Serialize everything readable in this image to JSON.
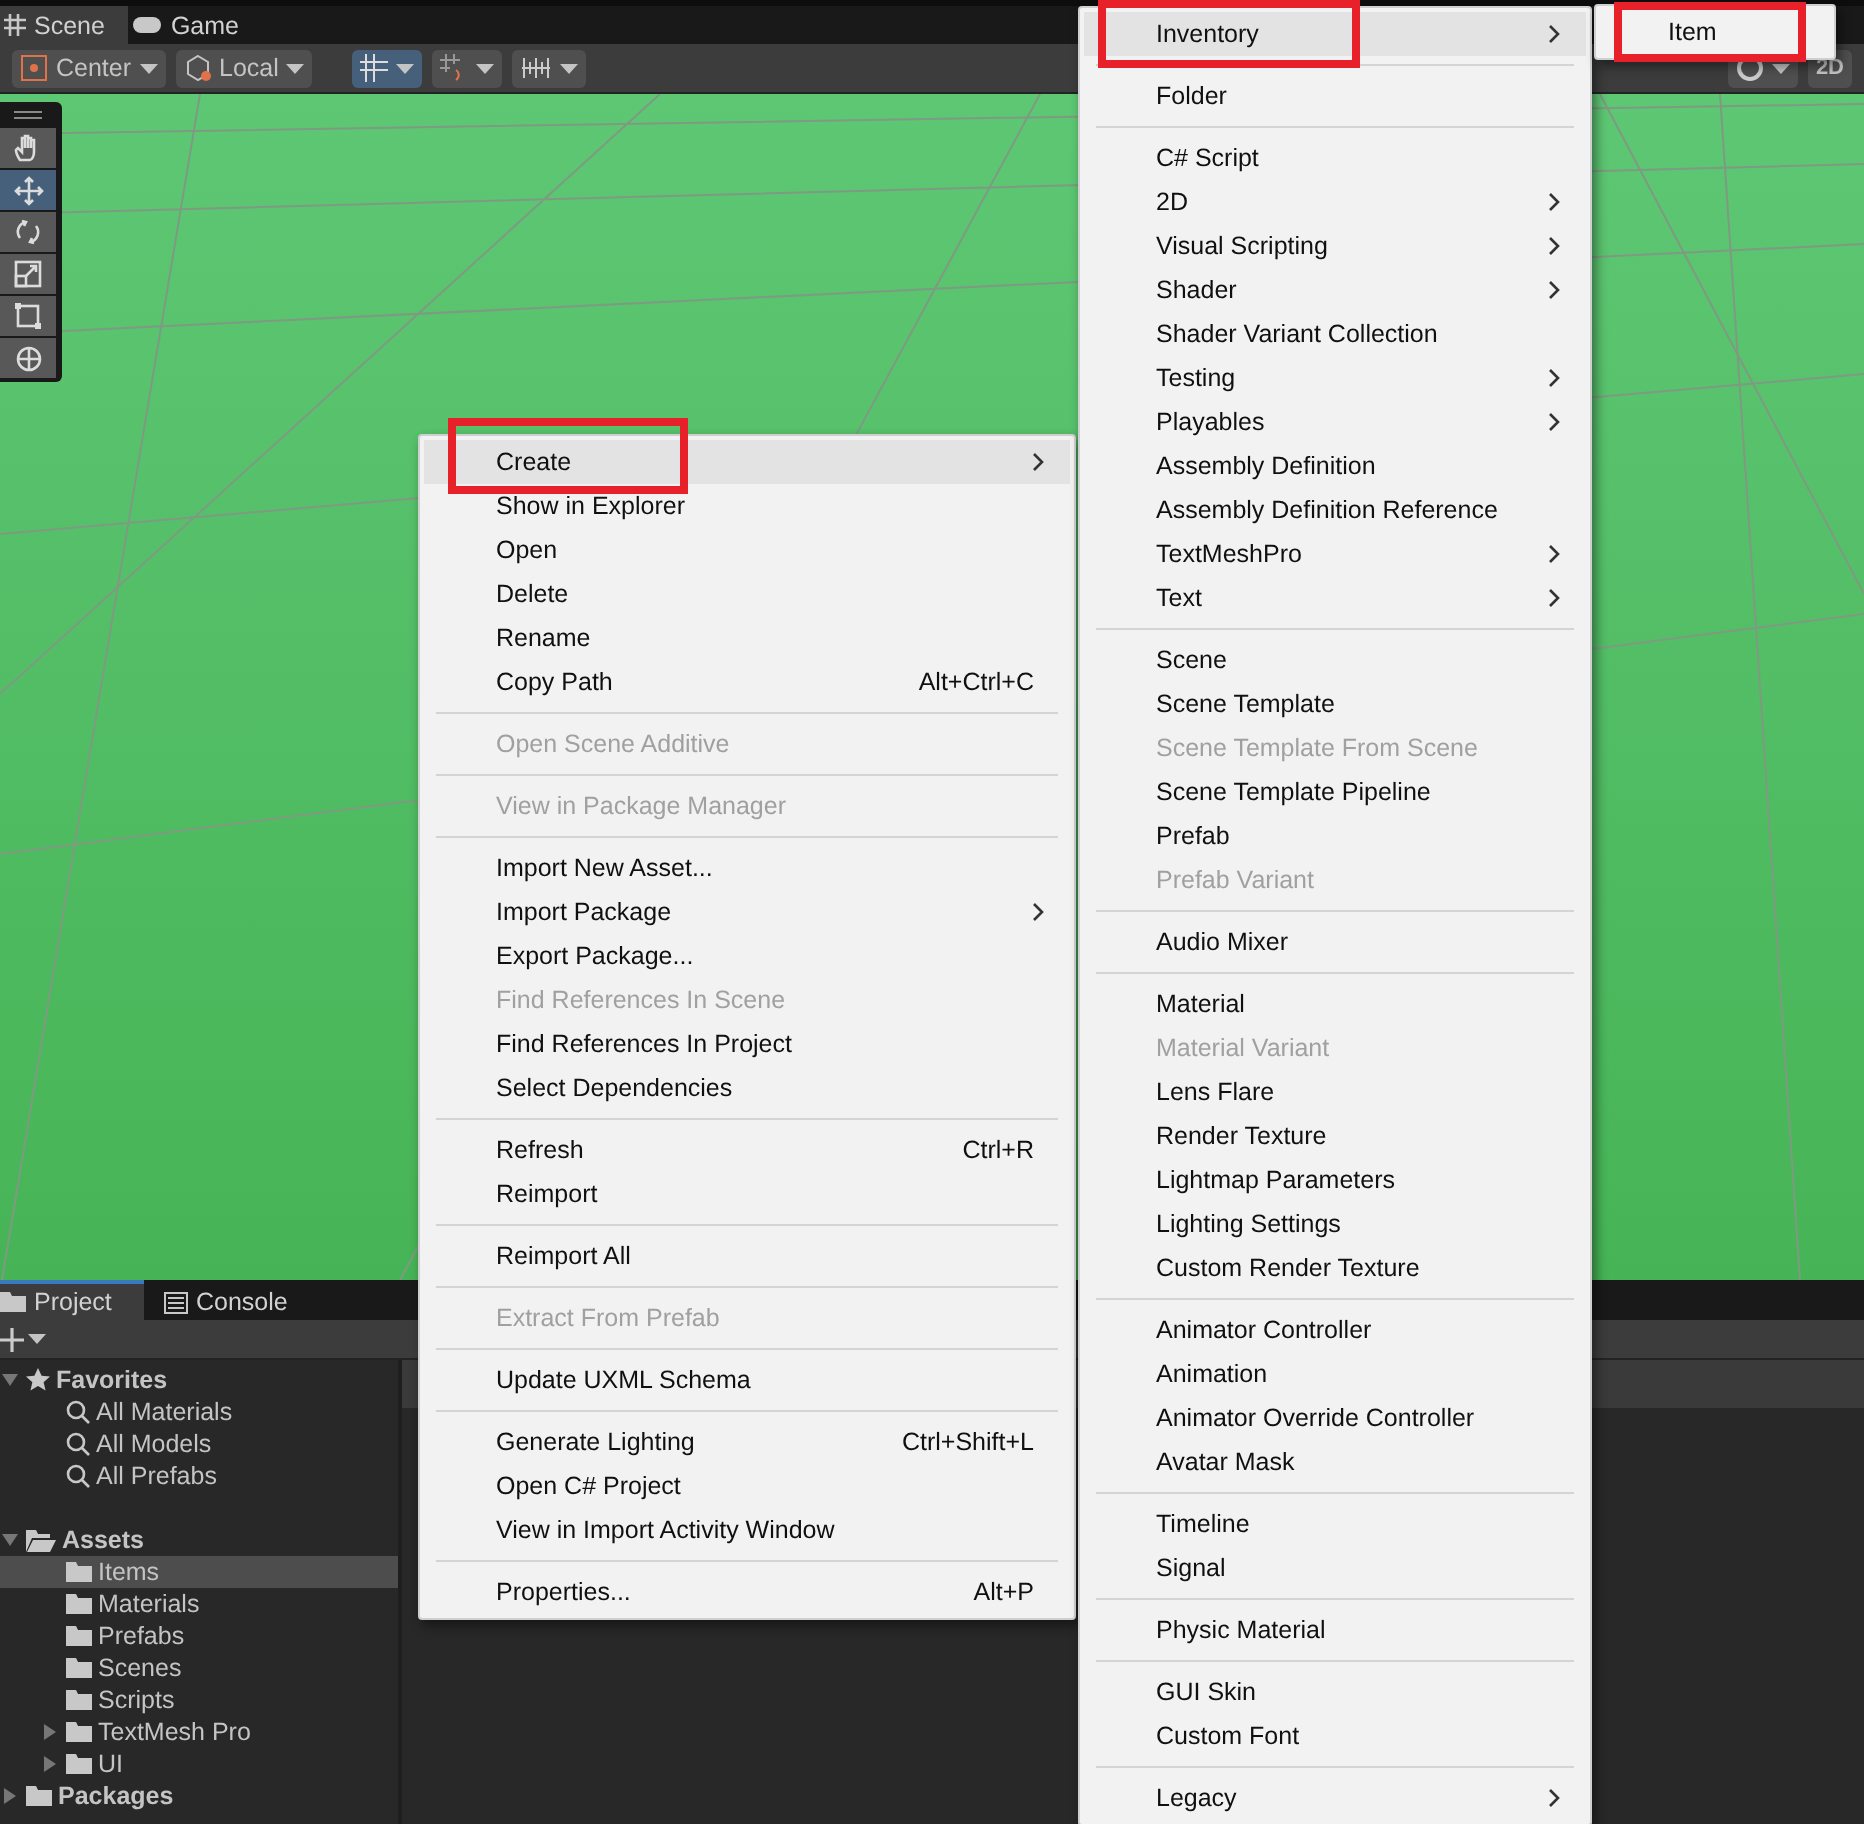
{
  "scene_tabs": [
    {
      "label": "Scene",
      "kind": "grid",
      "selected": true
    },
    {
      "label": "Game",
      "kind": "gamepad",
      "selected": false
    }
  ],
  "scene_toolbar": {
    "pivot": "Center",
    "space": "Local",
    "grid_snap_on": true,
    "view_mode": "2D"
  },
  "tools": [
    {
      "kind": "hand",
      "selected": false
    },
    {
      "kind": "move",
      "selected": true
    },
    {
      "kind": "rotate",
      "selected": false
    },
    {
      "kind": "scale",
      "selected": false
    },
    {
      "kind": "rect",
      "selected": false
    },
    {
      "kind": "transform",
      "selected": false
    }
  ],
  "bottom_tabs": [
    {
      "label": "Project",
      "kind": "folder",
      "selected": true
    },
    {
      "label": "Console",
      "kind": "console",
      "selected": false
    }
  ],
  "project_tree": [
    {
      "label": "Favorites",
      "kind": "star",
      "expanded": true,
      "selected": false,
      "children": [
        {
          "label": "All Materials",
          "kind": "search",
          "selected": false
        },
        {
          "label": "All Models",
          "kind": "search",
          "selected": false
        },
        {
          "label": "All Prefabs",
          "kind": "search",
          "selected": false
        }
      ]
    },
    {
      "label": "Assets",
      "kind": "folder",
      "expanded": true,
      "selected": false,
      "children": [
        {
          "label": "Items",
          "kind": "folder",
          "selected": true
        },
        {
          "label": "Materials",
          "kind": "folder",
          "selected": false
        },
        {
          "label": "Prefabs",
          "kind": "folder",
          "selected": false
        },
        {
          "label": "Scenes",
          "kind": "folder",
          "selected": false
        },
        {
          "label": "Scripts",
          "kind": "folder",
          "selected": false
        },
        {
          "label": "TextMesh Pro",
          "kind": "folder",
          "expanded": false,
          "selected": false
        },
        {
          "label": "UI",
          "kind": "folder",
          "expanded": false,
          "selected": false
        }
      ]
    },
    {
      "label": "Packages",
      "kind": "folder",
      "expanded": false,
      "selected": false
    }
  ],
  "context_menu": {
    "items": [
      {
        "kind": "item",
        "label": "Create",
        "submenu": true,
        "hovered": true,
        "highlighted": true
      },
      {
        "kind": "item",
        "label": "Show in Explorer"
      },
      {
        "kind": "item",
        "label": "Open"
      },
      {
        "kind": "item",
        "label": "Delete"
      },
      {
        "kind": "item",
        "label": "Rename"
      },
      {
        "kind": "item",
        "label": "Copy Path",
        "shortcut": "Alt+Ctrl+C"
      },
      {
        "kind": "separator"
      },
      {
        "kind": "item",
        "label": "Open Scene Additive",
        "disabled": true
      },
      {
        "kind": "separator"
      },
      {
        "kind": "item",
        "label": "View in Package Manager",
        "disabled": true
      },
      {
        "kind": "separator"
      },
      {
        "kind": "item",
        "label": "Import New Asset..."
      },
      {
        "kind": "item",
        "label": "Import Package",
        "submenu": true
      },
      {
        "kind": "item",
        "label": "Export Package..."
      },
      {
        "kind": "item",
        "label": "Find References In Scene",
        "disabled": true
      },
      {
        "kind": "item",
        "label": "Find References In Project"
      },
      {
        "kind": "item",
        "label": "Select Dependencies"
      },
      {
        "kind": "separator"
      },
      {
        "kind": "item",
        "label": "Refresh",
        "shortcut": "Ctrl+R"
      },
      {
        "kind": "item",
        "label": "Reimport"
      },
      {
        "kind": "separator"
      },
      {
        "kind": "item",
        "label": "Reimport All"
      },
      {
        "kind": "separator"
      },
      {
        "kind": "item",
        "label": "Extract From Prefab",
        "disabled": true
      },
      {
        "kind": "separator"
      },
      {
        "kind": "item",
        "label": "Update UXML Schema"
      },
      {
        "kind": "separator"
      },
      {
        "kind": "item",
        "label": "Generate Lighting",
        "shortcut": "Ctrl+Shift+L"
      },
      {
        "kind": "item",
        "label": "Open C# Project"
      },
      {
        "kind": "item",
        "label": "View in Import Activity Window"
      },
      {
        "kind": "separator"
      },
      {
        "kind": "item",
        "label": "Properties...",
        "shortcut": "Alt+P"
      }
    ]
  },
  "create_menu": {
    "items": [
      {
        "kind": "item",
        "label": "Inventory",
        "submenu": true,
        "hovered": true,
        "highlighted": true
      },
      {
        "kind": "separator"
      },
      {
        "kind": "item",
        "label": "Folder"
      },
      {
        "kind": "separator"
      },
      {
        "kind": "item",
        "label": "C# Script"
      },
      {
        "kind": "item",
        "label": "2D",
        "submenu": true
      },
      {
        "kind": "item",
        "label": "Visual Scripting",
        "submenu": true
      },
      {
        "kind": "item",
        "label": "Shader",
        "submenu": true
      },
      {
        "kind": "item",
        "label": "Shader Variant Collection"
      },
      {
        "kind": "item",
        "label": "Testing",
        "submenu": true
      },
      {
        "kind": "item",
        "label": "Playables",
        "submenu": true
      },
      {
        "kind": "item",
        "label": "Assembly Definition"
      },
      {
        "kind": "item",
        "label": "Assembly Definition Reference"
      },
      {
        "kind": "item",
        "label": "TextMeshPro",
        "submenu": true
      },
      {
        "kind": "item",
        "label": "Text",
        "submenu": true
      },
      {
        "kind": "separator"
      },
      {
        "kind": "item",
        "label": "Scene"
      },
      {
        "kind": "item",
        "label": "Scene Template"
      },
      {
        "kind": "item",
        "label": "Scene Template From Scene",
        "disabled": true
      },
      {
        "kind": "item",
        "label": "Scene Template Pipeline"
      },
      {
        "kind": "item",
        "label": "Prefab"
      },
      {
        "kind": "item",
        "label": "Prefab Variant",
        "disabled": true
      },
      {
        "kind": "separator"
      },
      {
        "kind": "item",
        "label": "Audio Mixer"
      },
      {
        "kind": "separator"
      },
      {
        "kind": "item",
        "label": "Material"
      },
      {
        "kind": "item",
        "label": "Material Variant",
        "disabled": true
      },
      {
        "kind": "item",
        "label": "Lens Flare"
      },
      {
        "kind": "item",
        "label": "Render Texture"
      },
      {
        "kind": "item",
        "label": "Lightmap Parameters"
      },
      {
        "kind": "item",
        "label": "Lighting Settings"
      },
      {
        "kind": "item",
        "label": "Custom Render Texture"
      },
      {
        "kind": "separator"
      },
      {
        "kind": "item",
        "label": "Animator Controller"
      },
      {
        "kind": "item",
        "label": "Animation"
      },
      {
        "kind": "item",
        "label": "Animator Override Controller"
      },
      {
        "kind": "item",
        "label": "Avatar Mask"
      },
      {
        "kind": "separator"
      },
      {
        "kind": "item",
        "label": "Timeline"
      },
      {
        "kind": "item",
        "label": "Signal"
      },
      {
        "kind": "separator"
      },
      {
        "kind": "item",
        "label": "Physic Material"
      },
      {
        "kind": "separator"
      },
      {
        "kind": "item",
        "label": "GUI Skin"
      },
      {
        "kind": "item",
        "label": "Custom Font"
      },
      {
        "kind": "separator"
      },
      {
        "kind": "item",
        "label": "Legacy",
        "submenu": true
      }
    ]
  },
  "inventory_menu": {
    "items": [
      {
        "kind": "item",
        "label": "Item",
        "highlighted": true
      }
    ]
  }
}
